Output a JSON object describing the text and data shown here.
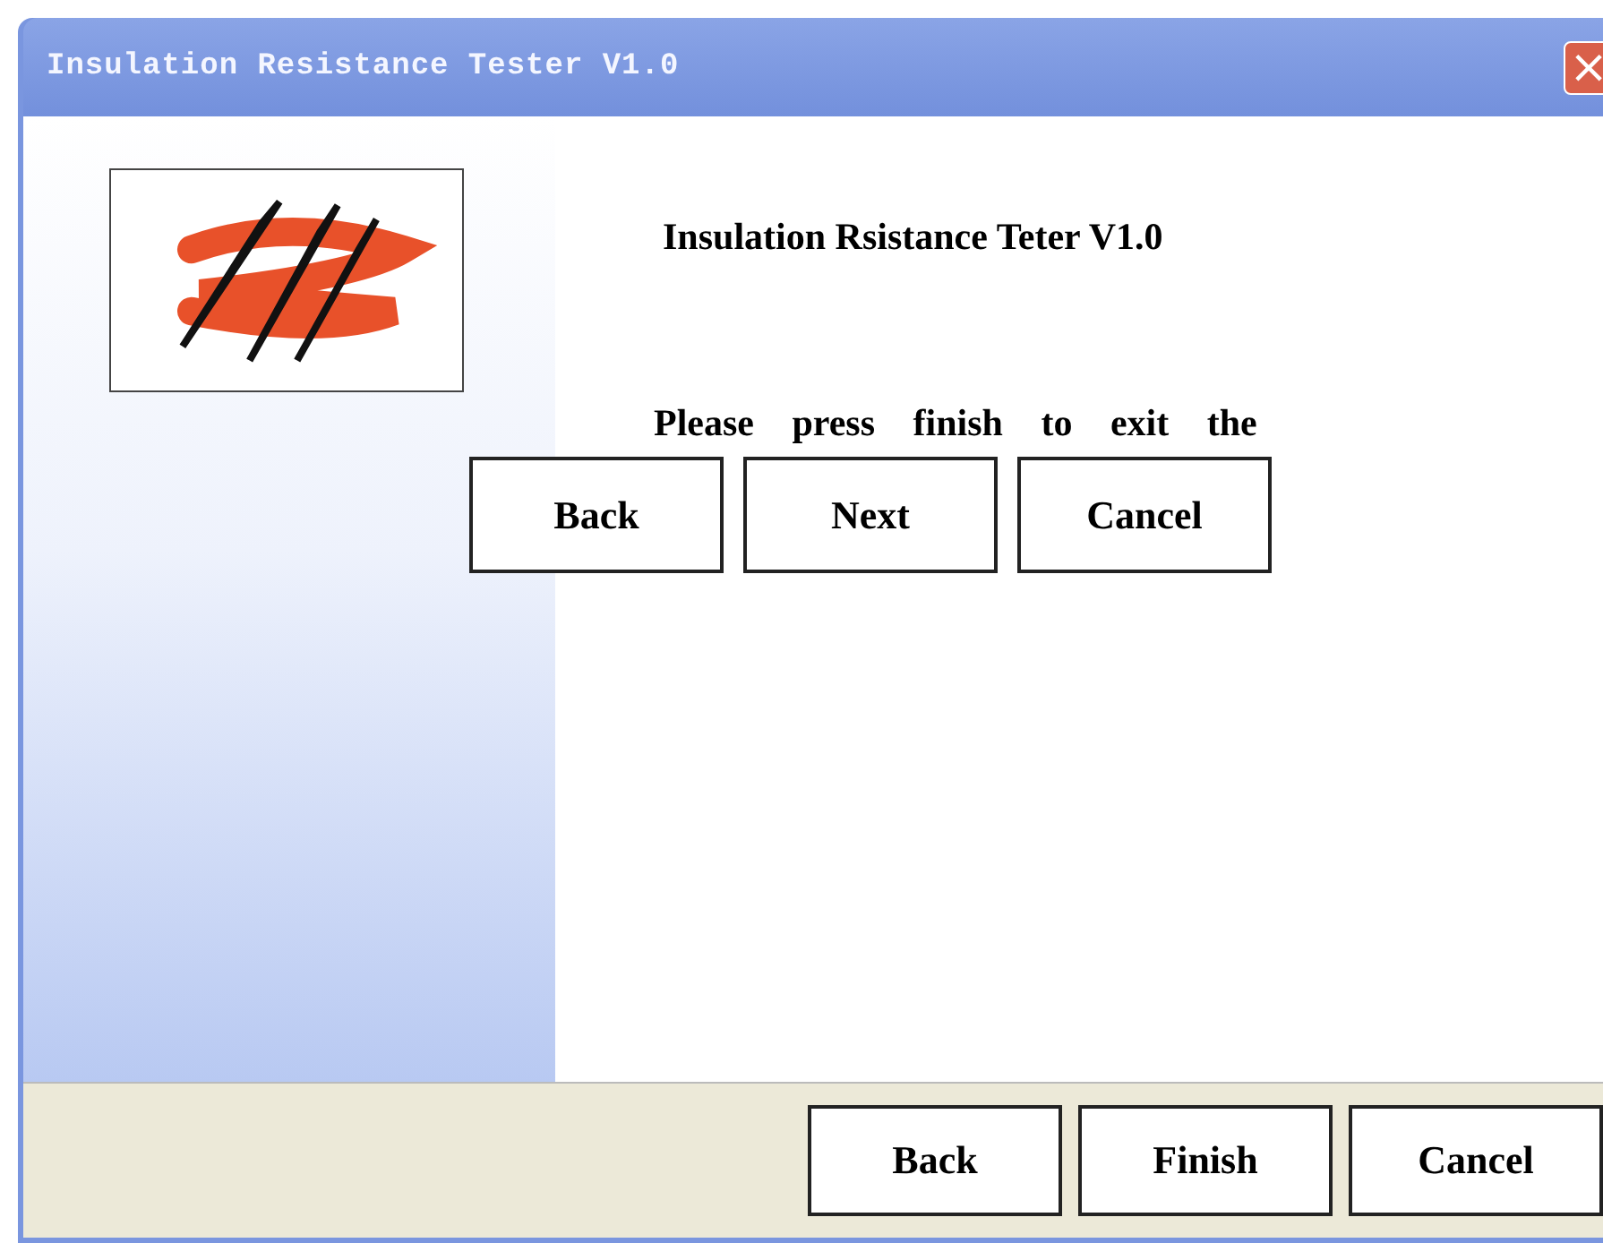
{
  "window": {
    "title": "Insulation Resistance Tester V1.0",
    "close": "×"
  },
  "heading": "Insulation Rsistance Teter V1.0",
  "message": "Please press finish to exit the",
  "inline_buttons": [
    "Back",
    "Next",
    "Cancel"
  ],
  "footer_buttons": [
    "Back",
    "Finish",
    "Cancel"
  ]
}
